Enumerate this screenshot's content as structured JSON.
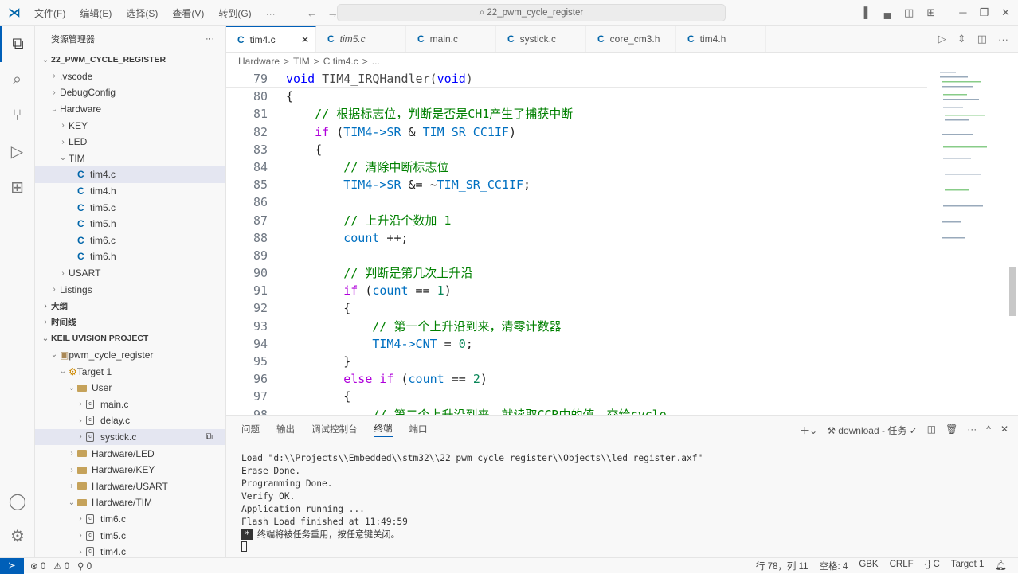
{
  "menu": [
    "文件(F)",
    "编辑(E)",
    "选择(S)",
    "查看(V)",
    "转到(G)",
    "···"
  ],
  "search": "22_pwm_cycle_register",
  "sidebar": {
    "title": "资源管理器",
    "more": "···",
    "explorer": [
      {
        "label": "22_PWM_CYCLE_REGISTER",
        "d": 0,
        "chev": "v",
        "sect": true
      },
      {
        "label": ".vscode",
        "d": 1,
        "chev": ">"
      },
      {
        "label": "DebugConfig",
        "d": 1,
        "chev": ">"
      },
      {
        "label": "Hardware",
        "d": 1,
        "chev": "v"
      },
      {
        "label": "KEY",
        "d": 2,
        "chev": ">"
      },
      {
        "label": "LED",
        "d": 2,
        "chev": ">"
      },
      {
        "label": "TIM",
        "d": 2,
        "chev": "v"
      },
      {
        "label": "tim4.c",
        "d": 3,
        "c": true,
        "sel": true
      },
      {
        "label": "tim4.h",
        "d": 3,
        "c": true
      },
      {
        "label": "tim5.c",
        "d": 3,
        "c": true
      },
      {
        "label": "tim5.h",
        "d": 3,
        "c": true
      },
      {
        "label": "tim6.c",
        "d": 3,
        "c": true
      },
      {
        "label": "tim6.h",
        "d": 3,
        "c": true
      },
      {
        "label": "USART",
        "d": 2,
        "chev": ">"
      },
      {
        "label": "Listings",
        "d": 1,
        "chev": ">"
      },
      {
        "label": "大纲",
        "d": 0,
        "chev": ">",
        "sect": true
      },
      {
        "label": "时间线",
        "d": 0,
        "chev": ">",
        "sect": true
      },
      {
        "label": "KEIL UVISION PROJECT",
        "d": 0,
        "chev": "v",
        "sect": true
      },
      {
        "label": "pwm_cycle_register",
        "d": 1,
        "chev": "v",
        "proj": true
      },
      {
        "label": "Target 1",
        "d": 2,
        "chev": "v",
        "target": true
      },
      {
        "label": "User",
        "d": 3,
        "chev": "v",
        "folder": true
      },
      {
        "label": "main.c",
        "d": 4,
        "chev": ">",
        "file": true
      },
      {
        "label": "delay.c",
        "d": 4,
        "chev": ">",
        "file": true
      },
      {
        "label": "systick.c",
        "d": 4,
        "chev": ">",
        "file": true,
        "sel": true
      },
      {
        "label": "Hardware/LED",
        "d": 3,
        "chev": ">",
        "folder": true
      },
      {
        "label": "Hardware/KEY",
        "d": 3,
        "chev": ">",
        "folder": true
      },
      {
        "label": "Hardware/USART",
        "d": 3,
        "chev": ">",
        "folder": true
      },
      {
        "label": "Hardware/TIM",
        "d": 3,
        "chev": "v",
        "folder": true
      },
      {
        "label": "tim6.c",
        "d": 4,
        "chev": ">",
        "file": true
      },
      {
        "label": "tim5.c",
        "d": 4,
        "chev": ">",
        "file": true
      },
      {
        "label": "tim4.c",
        "d": 4,
        "chev": ">",
        "file": true
      }
    ]
  },
  "tabs": [
    {
      "label": "tim4.c",
      "active": true
    },
    {
      "label": "tim5.c",
      "italic": true
    },
    {
      "label": "main.c"
    },
    {
      "label": "systick.c"
    },
    {
      "label": "core_cm3.h"
    },
    {
      "label": "tim4.h"
    }
  ],
  "breadcrumb": [
    "Hardware",
    ">",
    "TIM",
    ">",
    "C tim4.c",
    ">",
    "..."
  ],
  "code": [
    {
      "n": 79,
      "t": [
        [
          "void",
          "kw"
        ],
        [
          " TIM4_IRQHandler(",
          "fn"
        ],
        [
          "void",
          "kw"
        ],
        [
          ")",
          "fn"
        ]
      ]
    },
    {
      "n": 80,
      "t": [
        [
          "{",
          "pl"
        ]
      ]
    },
    {
      "n": 81,
      "t": [
        [
          "    // 根据标志位，判断是否是CH1产生了捕获中断",
          "cm"
        ]
      ]
    },
    {
      "n": 82,
      "t": [
        [
          "    ",
          "pl"
        ],
        [
          "if",
          "ctl"
        ],
        [
          " (",
          "pl"
        ],
        [
          "TIM4->SR",
          "mac"
        ],
        [
          " & ",
          "pl"
        ],
        [
          "TIM_SR_CC1IF",
          "mac"
        ],
        [
          ")",
          "pl"
        ]
      ]
    },
    {
      "n": 83,
      "t": [
        [
          "    {",
          "pl"
        ]
      ]
    },
    {
      "n": 84,
      "t": [
        [
          "        // 清除中断标志位",
          "cm"
        ]
      ]
    },
    {
      "n": 85,
      "t": [
        [
          "        ",
          "pl"
        ],
        [
          "TIM4->SR",
          "mac"
        ],
        [
          " &= ~",
          "pl"
        ],
        [
          "TIM_SR_CC1IF",
          "mac"
        ],
        [
          ";",
          "pl"
        ]
      ]
    },
    {
      "n": 86,
      "t": []
    },
    {
      "n": 87,
      "t": [
        [
          "        // 上升沿个数加 1",
          "cm"
        ]
      ]
    },
    {
      "n": 88,
      "t": [
        [
          "        ",
          "pl"
        ],
        [
          "count",
          "mac"
        ],
        [
          " ++;",
          "pl"
        ]
      ]
    },
    {
      "n": 89,
      "t": []
    },
    {
      "n": 90,
      "t": [
        [
          "        // 判断是第几次上升沿",
          "cm"
        ]
      ]
    },
    {
      "n": 91,
      "t": [
        [
          "        ",
          "pl"
        ],
        [
          "if",
          "ctl"
        ],
        [
          " (",
          "pl"
        ],
        [
          "count",
          "mac"
        ],
        [
          " == ",
          "pl"
        ],
        [
          "1",
          "num"
        ],
        [
          ")",
          "pl"
        ]
      ]
    },
    {
      "n": 92,
      "t": [
        [
          "        {",
          "pl"
        ]
      ]
    },
    {
      "n": 93,
      "t": [
        [
          "            // 第一个上升沿到来，清零计数器",
          "cm"
        ]
      ]
    },
    {
      "n": 94,
      "t": [
        [
          "            ",
          "pl"
        ],
        [
          "TIM4->CNT",
          "mac"
        ],
        [
          " = ",
          "pl"
        ],
        [
          "0",
          "num"
        ],
        [
          ";",
          "pl"
        ]
      ]
    },
    {
      "n": 95,
      "t": [
        [
          "        }",
          "pl"
        ]
      ]
    },
    {
      "n": 96,
      "t": [
        [
          "        ",
          "pl"
        ],
        [
          "else if",
          "ctl"
        ],
        [
          " (",
          "pl"
        ],
        [
          "count",
          "mac"
        ],
        [
          " == ",
          "pl"
        ],
        [
          "2",
          "num"
        ],
        [
          ")",
          "pl"
        ]
      ]
    },
    {
      "n": 97,
      "t": [
        [
          "        {",
          "pl"
        ]
      ]
    },
    {
      "n": 98,
      "t": [
        [
          "            // 第二个上升沿到来，就读取CCR中的值，交给cycle",
          "cm"
        ]
      ]
    }
  ],
  "panel": {
    "tabs": [
      "问题",
      "输出",
      "调试控制台",
      "终端",
      "端口"
    ],
    "active": 3,
    "task": "download - 任务",
    "terminal": [
      "Load \"d:\\\\Projects\\\\Embedded\\\\stm32\\\\22_pwm_cycle_register\\\\Objects\\\\led_register.axf\"",
      "Erase Done.",
      "Programming Done.",
      "Verify OK.",
      "Application running ...",
      "Flash Load finished at 11:49:59"
    ],
    "reuse": "终端将被任务重用，按任意键关闭。",
    "star": "*"
  },
  "status": {
    "errors": "⊗ 0",
    "warnings": "⚠ 0",
    "ports": "0",
    "right": [
      "行 78，列 11",
      "空格: 4",
      "GBK",
      "CRLF",
      "{} C",
      "Target 1"
    ]
  }
}
